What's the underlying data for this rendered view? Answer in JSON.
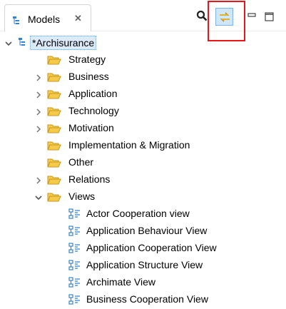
{
  "tab": {
    "title": "Models",
    "close_glyph": "✕"
  },
  "tree": {
    "root": "*Archisurance",
    "folders": [
      "Strategy",
      "Business",
      "Application",
      "Technology",
      "Motivation",
      "Implementation & Migration",
      "Other",
      "Relations",
      "Views"
    ],
    "views": [
      "Actor Cooperation view",
      "Application Behaviour View",
      "Application Cooperation View",
      "Application Structure View",
      "Archimate View",
      "Business Cooperation View"
    ]
  },
  "colors": {
    "folder": "#f5c94a",
    "folder_edge": "#c79a1e",
    "view_icon": "#3b82c4",
    "selection": "#dceafb",
    "highlight": "#e8151b"
  },
  "icons": {
    "tab": "model-tree-icon",
    "search": "search-icon",
    "link": "link-with-editor-icon",
    "minimize": "minimize-icon",
    "maximize": "maximize-icon",
    "folder": "folder-open-icon",
    "view": "diagram-view-icon"
  }
}
